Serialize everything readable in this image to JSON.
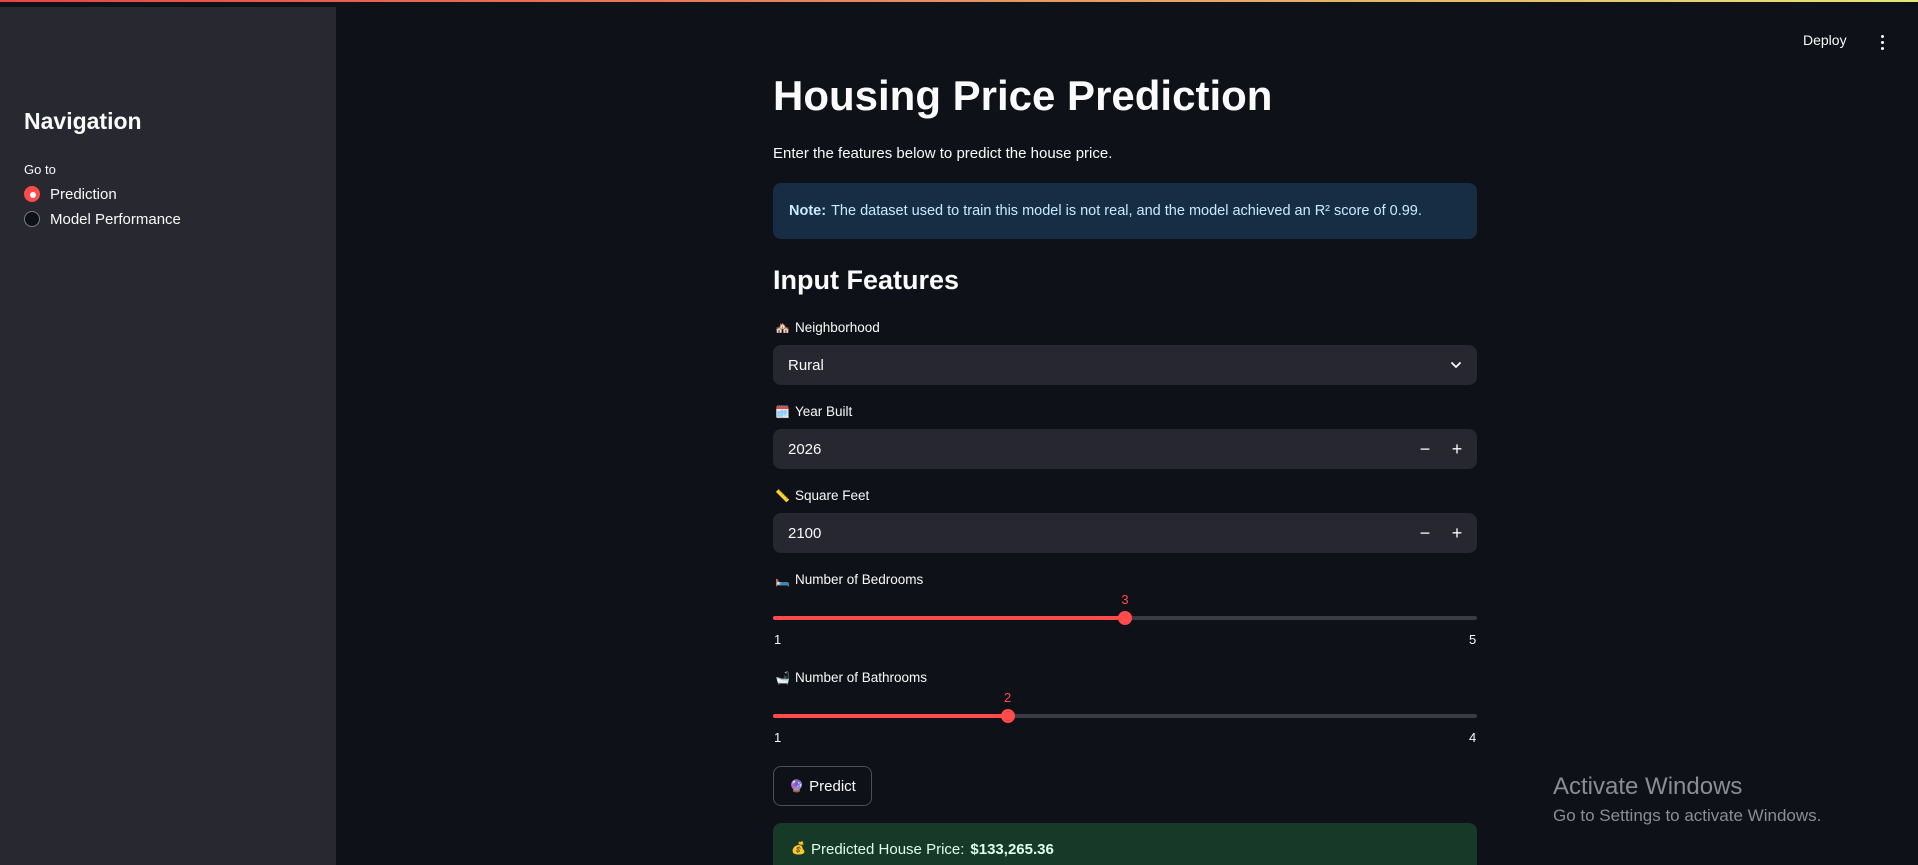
{
  "header": {
    "deploy_label": "Deploy",
    "menu_icon": "vertical-ellipsis-icon"
  },
  "sidebar": {
    "title": "Navigation",
    "goto_label": "Go to",
    "options": [
      {
        "label": "Prediction",
        "selected": true
      },
      {
        "label": "Model Performance",
        "selected": false
      }
    ]
  },
  "main": {
    "title": "Housing Price Prediction",
    "subtitle": "Enter the features below to predict the house price.",
    "note": {
      "bold": "Note:",
      "text": "The dataset used to train this model is not real, and the model achieved an R² score of 0.99."
    },
    "section_title": "Input Features",
    "neighborhood": {
      "emoji": "🏘️",
      "label": "Neighborhood",
      "value": "Rural"
    },
    "year_built": {
      "emoji": "🗓️",
      "label": "Year Built",
      "value": "2026",
      "minus": "−",
      "plus": "+"
    },
    "square_feet": {
      "emoji": "📏",
      "label": "Square Feet",
      "value": "2100",
      "minus": "−",
      "plus": "+"
    },
    "bedrooms": {
      "emoji": "🛏️",
      "label": "Number of Bedrooms",
      "value": "3",
      "min": "1",
      "max": "5",
      "fraction": 0.5
    },
    "bathrooms": {
      "emoji": "🛁",
      "label": "Number of Bathrooms",
      "value": "2",
      "min": "1",
      "max": "4",
      "fraction": 0.3333
    },
    "predict_button": {
      "emoji": "🔮",
      "label": "Predict"
    },
    "result": {
      "emoji": "💰",
      "label": "Predicted House Price:",
      "value": "$133,265.36"
    }
  },
  "watermark": {
    "title": "Activate Windows",
    "subtitle": "Go to Settings to activate Windows."
  },
  "colors": {
    "accent": "#ff4b4b",
    "background": "#0e1117",
    "sidebar": "#262730",
    "info_bg": "#172d43",
    "success_bg": "#173928"
  }
}
